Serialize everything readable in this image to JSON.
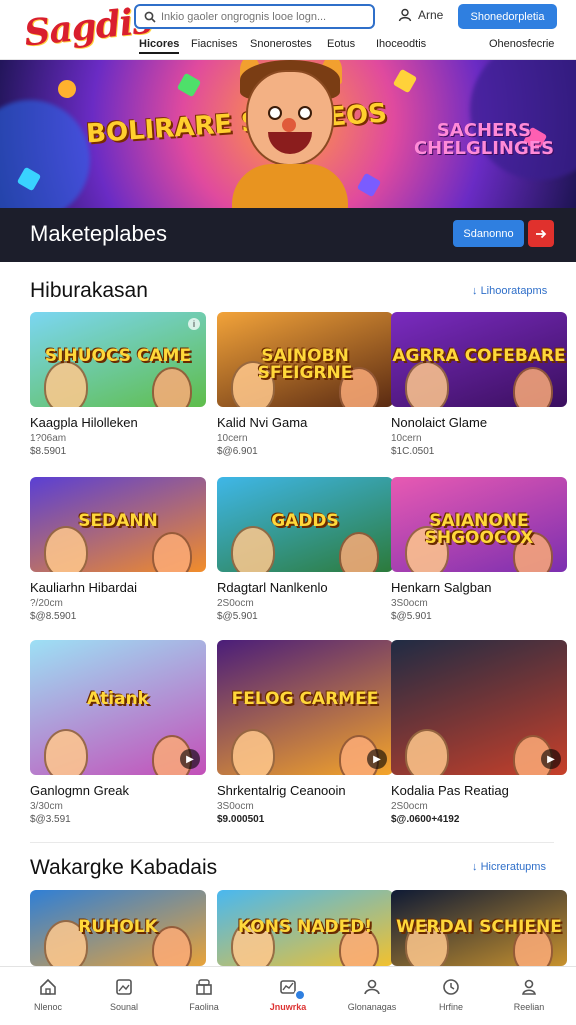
{
  "brand": {
    "logo_text": "Sagdis"
  },
  "search": {
    "placeholder": "Inkio gaoler ongrognis looe logn..."
  },
  "account": {
    "label": "Arne"
  },
  "header_cta": {
    "label": "Shonedorpletia"
  },
  "nav": [
    {
      "label": "Hicores",
      "active": true
    },
    {
      "label": "Fiacnises"
    },
    {
      "label": "Snonerostes"
    },
    {
      "label": "Eotus"
    },
    {
      "label": "Ihoceodtis"
    },
    {
      "label": "Ohenosfecrie"
    }
  ],
  "hero": {
    "art_title_left": "BOLIRARE SHUMEOS",
    "art_title_right": "SACHERS CHELGLINGES",
    "bar_title": "Maketeplabes",
    "primary_button": "Sdanonno",
    "arrow_icon": "arrow-right-icon"
  },
  "sections": [
    {
      "title": "Hiburakasan",
      "link": "Lihooratapms",
      "cards": [
        {
          "art_text": "SIHUOCS CAME",
          "name": "Kaagpla Hilolleken",
          "meta1": "1?06am",
          "meta2": "$8.5901",
          "palette": [
            "#7bd6f2",
            "#5fbd4a"
          ]
        },
        {
          "art_text": "SAINOBN SFEIGRNE",
          "name": "Kalid Nvi Gama",
          "meta1": "10cern",
          "meta2": "$@6.901",
          "palette": [
            "#f2a33a",
            "#5a2a12"
          ]
        },
        {
          "art_text": "AGRRA COFEBARE",
          "name": "Nonolaict Glame",
          "meta1": "10cern",
          "meta2": "$1C.0501",
          "palette": [
            "#7a2bbf",
            "#3a0f5e"
          ]
        },
        {
          "art_text": "SEDANN",
          "name": "Kauliarhn Hibardai",
          "meta1": "?/20cm",
          "meta2": "$@8.5901",
          "palette": [
            "#5a3fd4",
            "#f28d2a"
          ]
        },
        {
          "art_text": "GADDS",
          "name": "Rdagtarl Nanlkenlo",
          "meta1": "2S0ocm",
          "meta2": "$@5.901",
          "palette": [
            "#3fb7e8",
            "#2c7a3a"
          ]
        },
        {
          "art_text": "SAIANONE SHGOOCOX",
          "name": "Henkarn Salgban",
          "meta1": "3S0ocm",
          "meta2": "$@5.901",
          "palette": [
            "#e85ab2",
            "#7b2fb0"
          ]
        },
        {
          "art_text": "Atiank",
          "name": "Ganlogmn Greak",
          "meta1": "3/30cm",
          "meta2": "$@3.591",
          "palette": [
            "#9de0f5",
            "#c34fb8"
          ],
          "tall": true
        },
        {
          "art_text": "FELOG CARMEE",
          "name": "Shrkentalrig Ceanooin",
          "meta1": "3S0ocm",
          "meta2": "$9.000501",
          "meta2_bold": true,
          "palette": [
            "#4a1d7a",
            "#f5a52a"
          ],
          "tall": true
        },
        {
          "art_text": "",
          "name": "Kodalia Pas Reatiag",
          "meta1": "2S0ocm",
          "meta2": "$@.0600+4192",
          "meta2_bold": true,
          "palette": [
            "#1f2b44",
            "#c7402a"
          ],
          "tall": true
        }
      ]
    },
    {
      "title": "Wakargke Kabadais",
      "link": "Hicreratupms",
      "cards": [
        {
          "art_text": "RUHOLK",
          "palette": [
            "#2f7fd6",
            "#e8a33a"
          ]
        },
        {
          "art_text": "KONS NADED!",
          "palette": [
            "#49b8f0",
            "#f2c12e"
          ]
        },
        {
          "art_text": "WERDAI SCHIENE",
          "palette": [
            "#0e1a35",
            "#c8922e"
          ]
        }
      ]
    }
  ],
  "bottom_nav": [
    {
      "label": "Nlenoc",
      "icon": "home-icon"
    },
    {
      "label": "Sounal",
      "icon": "gallery-icon"
    },
    {
      "label": "Faolina",
      "icon": "gift-icon"
    },
    {
      "label": "Jnuwrka",
      "icon": "chart-icon",
      "active": true
    },
    {
      "label": "Glonanagas",
      "icon": "users-icon"
    },
    {
      "label": "Hrfine",
      "icon": "clock-icon"
    },
    {
      "label": "Reelian",
      "icon": "profile-icon"
    }
  ]
}
